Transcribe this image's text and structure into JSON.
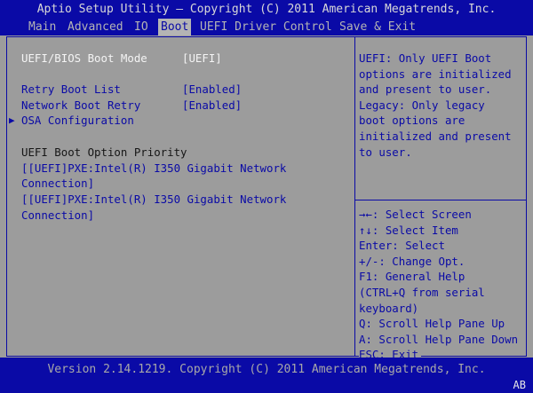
{
  "title": "Aptio Setup Utility – Copyright (C) 2011 American Megatrends, Inc.",
  "menu": [
    {
      "label": "Main"
    },
    {
      "label": "Advanced"
    },
    {
      "label": "IO"
    },
    {
      "label": "Boot"
    },
    {
      "label": "UEFI Driver Control"
    },
    {
      "label": "Save & Exit"
    }
  ],
  "settings": {
    "boot_mode": {
      "label": "UEFI/BIOS Boot Mode",
      "value": "[UEFI]"
    },
    "retry_boot_list": {
      "label": "Retry Boot List",
      "value": "[Enabled]"
    },
    "network_boot_retry": {
      "label": "Network Boot Retry",
      "value": "[Enabled]"
    },
    "osa_configuration": {
      "arrow": "▶",
      "label": "OSA Configuration"
    },
    "priority_heading": "UEFI Boot Option Priority",
    "boot_options": [
      {
        "line1": "[[UEFI]PXE:Intel(R) I350 Gigabit Network",
        "line2": "Connection]"
      },
      {
        "line1": "[[UEFI]PXE:Intel(R) I350 Gigabit Network",
        "line2": "Connection]"
      }
    ]
  },
  "help_text": [
    "UEFI: Only UEFI Boot",
    "options are initialized",
    "and present to user.",
    "Legacy: Only legacy",
    "boot options are",
    "initialized and present",
    "to user."
  ],
  "key_help": [
    "→←: Select Screen",
    "↑↓: Select Item",
    "Enter: Select",
    "+/-: Change Opt.",
    "F1: General Help",
    "(CTRL+Q from serial",
    "keyboard)",
    "Q: Scroll Help Pane Up",
    "A: Scroll Help Pane Down",
    "ESC: Exit"
  ],
  "footer": {
    "version": "Version 2.14.1219. Copyright (C) 2011 American Megatrends, Inc.",
    "corner_code": "AB"
  },
  "colors": {
    "background": "#9c9c9c",
    "bar": "#0a0aa6",
    "accent_text": "#0a0aa6",
    "highlight_text": "#f4f4f4"
  }
}
